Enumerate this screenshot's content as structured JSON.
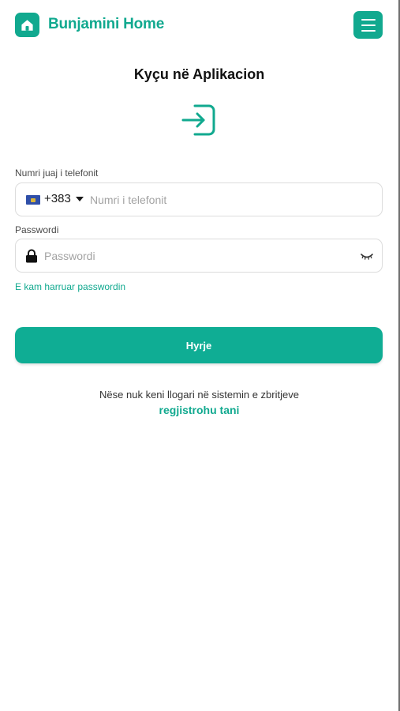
{
  "header": {
    "brand": "Bunjamini Home",
    "logo_icon": "home-icon",
    "menu_icon": "hamburger-menu-icon"
  },
  "title": "Kyçu në Aplikacion",
  "login_icon": "login-arrow-icon",
  "phone": {
    "label": "Numri juaj i telefonit",
    "country_code": "+383",
    "flag": "kosovo-flag-icon",
    "placeholder": "Numri i telefonit"
  },
  "password": {
    "label": "Passwordi",
    "placeholder": "Passwordi",
    "lock_icon": "lock-icon",
    "toggle_icon": "eye-closed-icon"
  },
  "forgot_link": "E kam harruar passwordin",
  "submit_label": "Hyrje",
  "register": {
    "text": "Nëse nuk keni llogari në sistemin e zbritjeve",
    "link": "regjistrohu tani"
  },
  "colors": {
    "accent": "#11a98f",
    "button": "#0fad94",
    "border": "#dcdcdc"
  }
}
